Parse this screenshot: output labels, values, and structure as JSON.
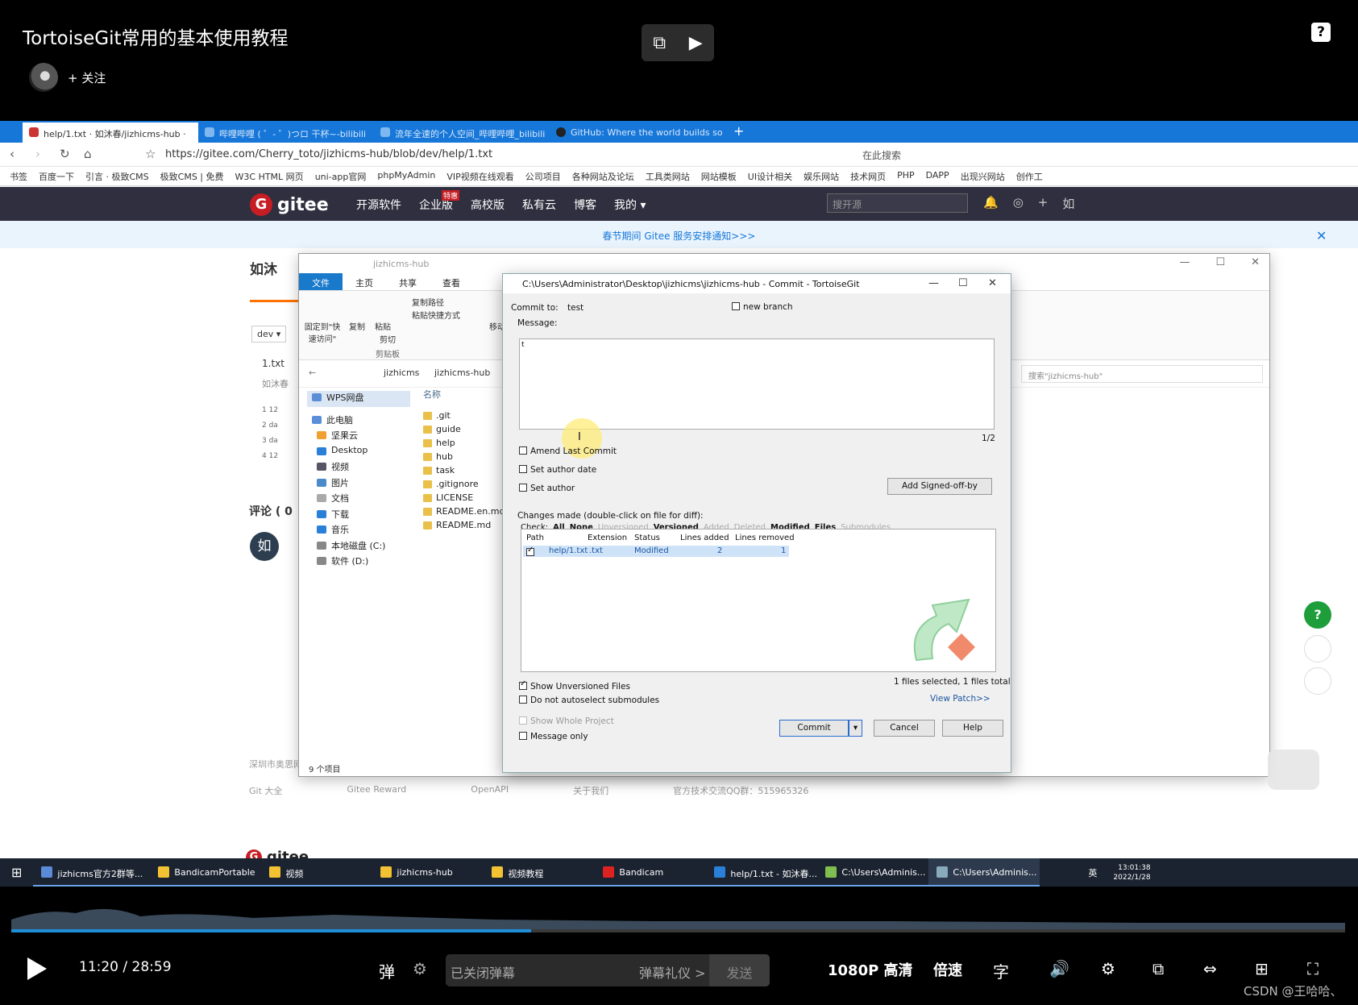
{
  "player": {
    "title": "TortoiseGit常用的基本使用教程",
    "follow": "+ 关注",
    "help": "?",
    "time_current": "11:20",
    "time_sep": "/",
    "time_total": "28:59",
    "progress": 0.39,
    "danmu_placeholder": "已关闭弹幕",
    "danmu_etiquette": "弹幕礼仪 >",
    "send": "发送",
    "quality": "1080P 高清",
    "speed": "倍速",
    "watermark": "CSDN @王哈哈、"
  },
  "browser": {
    "tabs": [
      "help/1.txt · 如沐春/jizhicms-hub ·",
      "哔哩哔哩 ( ゜- ゜)つロ 干杯~-bilibili",
      "流年全速的个人空间_哔哩哔哩_bilibili",
      "GitHub: Where the world builds so"
    ],
    "url": "https://gitee.com/Cherry_toto/jizhicms-hub/blob/dev/help/1.txt",
    "search": "在此搜索",
    "bookmarks": [
      "书签",
      "百度一下",
      "引言 · 极致CMS",
      "极致CMS | 免费",
      "W3C HTML 网页",
      "uni-app官网",
      "phpMyAdmin",
      "VIP视频在线观看",
      "公司项目",
      "各种网站及论坛",
      "工具类网站",
      "网站模板",
      "UI设计相关",
      "娱乐网站",
      "技术网页",
      "PHP",
      "DAPP",
      "出现兴网站",
      "创作工"
    ]
  },
  "gitee": {
    "logo": "gitee",
    "nav": [
      "开源软件",
      "企业版",
      "高校版",
      "私有云",
      "博客",
      "我的 ▾"
    ],
    "badge": "特惠",
    "search_placeholder": "搜开源",
    "user": "如",
    "notice": "春节期间 Gitee 服务安排通知>>>",
    "repo_title": "如沐",
    "branch": "dev ▾",
    "file": "1.txt",
    "author": "如沐春",
    "code_lines": [
      "1  12",
      "2  da",
      "3  da",
      "4  12"
    ],
    "comments": "评论 ( 0",
    "avatar_char": "如",
    "footer_company": "深圳市奥思网络科技有限公司版权所有",
    "footer_links": [
      "Git 大全",
      "Gitee Reward",
      "OpenAPI",
      "关于我们",
      "官方技术交流QQ群：515965326"
    ]
  },
  "explorer": {
    "title": "jizhicms-hub",
    "ribbon_tabs": [
      "文件",
      "主页",
      "共享",
      "查看"
    ],
    "ribbon_items": [
      "固定到\"快速访问\"",
      "复制",
      "粘贴",
      "复制路径",
      "粘贴快捷方式",
      "剪切",
      "剪贴板",
      "移动"
    ],
    "path": [
      "jizhicms",
      "jizhicms-hub"
    ],
    "search": "搜索\"jizhicms-hub\"",
    "nav": [
      "WPS网盘",
      "此电脑",
      "坚果云",
      "Desktop",
      "视频",
      "图片",
      "文档",
      "下载",
      "音乐",
      "本地磁盘 (C:)",
      "软件 (D:)"
    ],
    "col_name": "名称",
    "files": [
      ".git",
      "guide",
      "help",
      "hub",
      "task",
      ".gitignore",
      "LICENSE",
      "README.en.md",
      "README.md"
    ],
    "status": "9 个项目"
  },
  "commit_dialog": {
    "title": "C:\\Users\\Administrator\\Desktop\\jizhicms\\jizhicms-hub - Commit - TortoiseGit",
    "commit_to_label": "Commit to:",
    "commit_to_value": "test",
    "new_branch": "new branch",
    "message_label": "Message:",
    "message_text": "t",
    "counter": "1/2",
    "amend": "Amend Last Commit",
    "set_author_date": "Set author date",
    "set_author": "Set author",
    "signed_off": "Add Signed-off-by",
    "changes_label": "Changes made (double-click on file for diff):",
    "check_label": "Check:",
    "check_filters": [
      "All",
      "None",
      "Unversioned",
      "Versioned",
      "Added",
      "Deleted",
      "Modified",
      "Files",
      "Submodules"
    ],
    "columns": [
      "Path",
      "Extension",
      "Status",
      "Lines added",
      "Lines removed"
    ],
    "rows": [
      {
        "path": "help/1.txt",
        "ext": ".txt",
        "status": "Modified",
        "added": "2",
        "removed": "1"
      }
    ],
    "show_unversioned": "Show Unversioned Files",
    "no_autoselect": "Do not autoselect submodules",
    "selected_info": "1 files selected, 1 files total",
    "view_patch": "View Patch>>",
    "show_whole_project": "Show Whole Project",
    "message_only": "Message only",
    "commit_btn": "Commit",
    "cancel_btn": "Cancel",
    "help_btn": "Help"
  },
  "taskbar": {
    "items": [
      "jizhicms官方2群等...",
      "BandicamPortable",
      "视频",
      "jizhicms-hub",
      "视频教程",
      "Bandicam",
      "help/1.txt - 如沐春...",
      "C:\\Users\\Adminis...",
      "C:\\Users\\Adminis..."
    ],
    "time": "13:01:38",
    "date": "2022/1/28",
    "ime": "英"
  }
}
